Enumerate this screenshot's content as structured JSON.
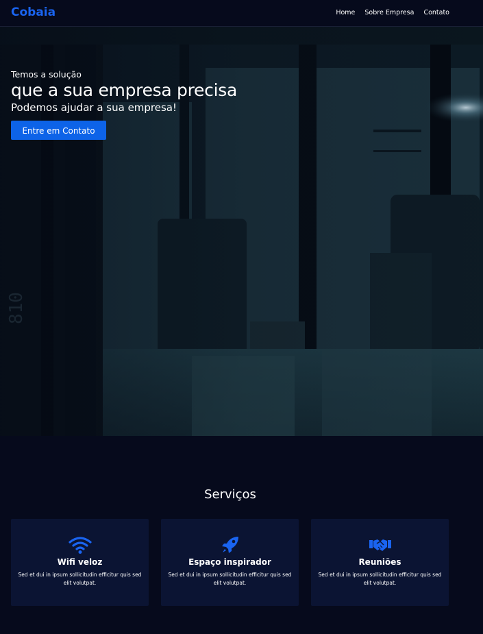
{
  "nav": {
    "brand": "Cobaia",
    "links": [
      "Home",
      "Sobre Empresa",
      "Contato"
    ]
  },
  "hero": {
    "kicker": "Temos a solução",
    "title": "que a sua empresa precisa",
    "subtitle": "Podemos ajudar a sua empresa!",
    "button_label": "Entre em Contato"
  },
  "services": {
    "title": "Serviços",
    "cards": [
      {
        "icon": "wifi-icon",
        "title": "Wifi veloz",
        "text": "Sed et dui in ipsum sollicitudin efficitur quis sed elit volutpat."
      },
      {
        "icon": "rocket-icon",
        "title": "Espaço inspirador",
        "text": "Sed et dui in ipsum sollicitudin efficitur quis sed elit volutpat."
      },
      {
        "icon": "handshake-icon",
        "title": "Reuniões",
        "text": "Sed et dui in ipsum sollicitudin efficitur quis sed elit volutpat."
      }
    ]
  },
  "colors": {
    "accent": "#1a64f0",
    "button": "#0d63e8",
    "page_bg": "#060a1c",
    "card_bg": "#0b1433"
  }
}
